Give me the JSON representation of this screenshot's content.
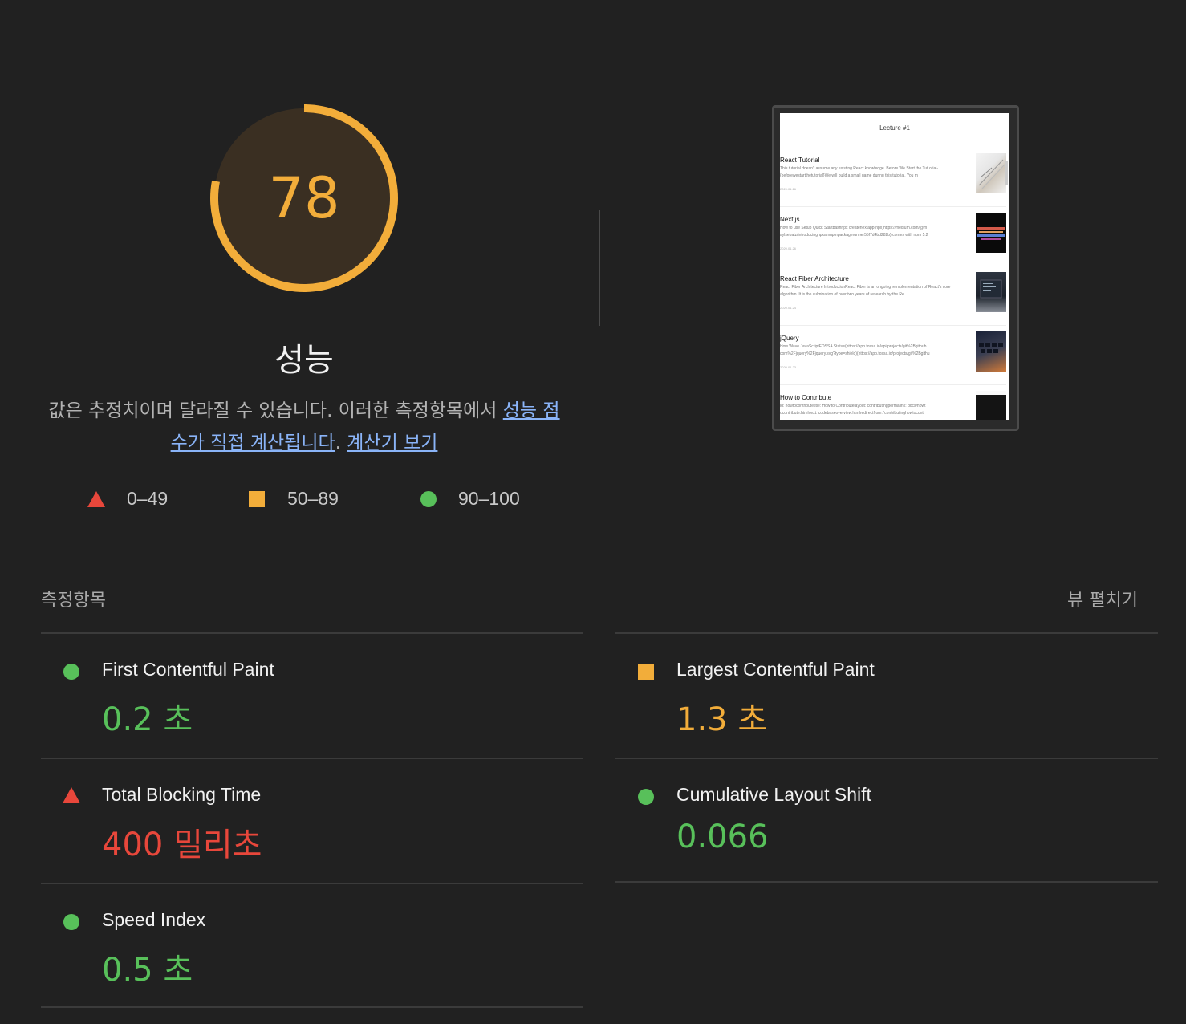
{
  "gauge": {
    "score": "78",
    "fraction": 0.78,
    "color": "#f2ad3a",
    "bg": "#3a2f22"
  },
  "category": {
    "title": "성능",
    "desc_text": "값은 추정치이며 달라질 수 있습니다. 이러한 측정항목에서 ",
    "link1": "성능 점수가 직접 계산됩니다",
    "desc_mid": ". ",
    "link2": "계산기 보기"
  },
  "legend": [
    {
      "shape": "triangle",
      "range": "0–49",
      "color": "#e8473b"
    },
    {
      "shape": "square",
      "range": "50–89",
      "color": "#f2ad3a"
    },
    {
      "shape": "circle",
      "range": "90–100",
      "color": "#58c05a"
    }
  ],
  "screenshot": {
    "page_title": "Lecture #1",
    "posts": [
      {
        "title": "React Tutorial",
        "excerpt": "This tutorial doesn't assume any existing React knowledge. Before We Start the Tut orial-{beforewestartthetutorial}We will build a small game during this tutorial. You m",
        "date": "2020.01.26",
        "thumb": "thumb-notebook"
      },
      {
        "title": "Next.js",
        "excerpt": "How to use Setup Quick Startbashnpx createnextapp(npx)https://medium.com/@m aylsebatz/introducingnpxanmpmpackagerunner55f7d4bd282b) comes with npm 5.2",
        "date": "2020.01.26",
        "thumb": "thumb-lights"
      },
      {
        "title": "React Fiber Architecture",
        "excerpt": "React Fiber Architecture IntroductionReact Fiber is an ongoing reimplementation of React's core algorithm. It is the culmination of over two years of research by the Re",
        "date": "2020.01.24",
        "thumb": "thumb-laptop"
      },
      {
        "title": "jQuery",
        "excerpt": "How Wave JavaScriptFOSSA Status(https://app.fossa.io/api/projects/git%2Bgithub. com%2Fjquery%2Fjquery.svg?type=shield)(https://app.fossa.io/projects/git%2Bgithu",
        "date": "2020.01.23",
        "thumb": "thumb-keyboard"
      },
      {
        "title": "How to Contribute",
        "excerpt": "id: howtocontributetitle: How to Contributelayout: contributingpermalink: docs/howt ocontribute.htmlnext: codebaseoverview.htmlredirectfrom: 'contributinghowtocont",
        "date": "",
        "thumb": "thumb-dark"
      }
    ]
  },
  "metrics": {
    "label": "측정항목",
    "expand": "뷰 펼치기",
    "items": [
      {
        "name": "First Contentful Paint",
        "value": "0.2 초",
        "status": "green"
      },
      {
        "name": "Largest Contentful Paint",
        "value": "1.3 초",
        "status": "orange"
      },
      {
        "name": "Total Blocking Time",
        "value": "400 밀리초",
        "status": "red"
      },
      {
        "name": "Cumulative Layout Shift",
        "value": "0.066",
        "status": "green"
      },
      {
        "name": "Speed Index",
        "value": "0.5 초",
        "status": "green"
      }
    ]
  }
}
